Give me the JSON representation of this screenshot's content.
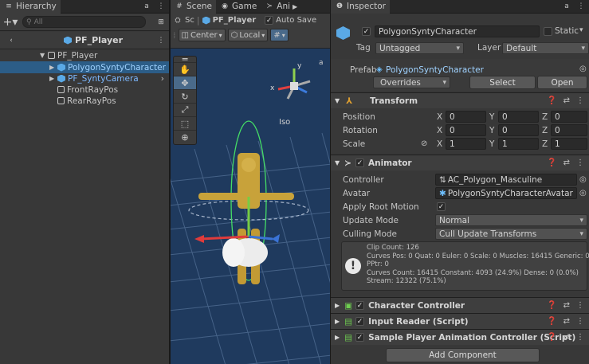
{
  "hierarchy": {
    "tab_label": "Hierarchy",
    "search_placeholder": "All",
    "header_title": "PF_Player",
    "tree": [
      {
        "label": "PF_Player"
      },
      {
        "label": "PolygonSyntyCharacter"
      },
      {
        "label": "PF_SyntyCamera"
      },
      {
        "label": "FrontRayPos"
      },
      {
        "label": "RearRayPos"
      }
    ]
  },
  "scene": {
    "tabs": [
      {
        "label": "Scene"
      },
      {
        "label": "Game"
      },
      {
        "label": "Ani"
      }
    ],
    "breadcrumb_sc": "Sc",
    "breadcrumb_player": "PF_Player",
    "auto_save_label": "Auto Save",
    "pivot_label": "Center",
    "space_label": "Local",
    "iso_label": "Iso",
    "axis_y": "y",
    "axis_x": "x"
  },
  "inspector": {
    "tab_label": "Inspector",
    "object_name": "PolygonSyntyCharacter",
    "static_label": "Static",
    "tag_label": "Tag",
    "tag_value": "Untagged",
    "layer_label": "Layer",
    "layer_value": "Default",
    "prefab_label": "Prefab",
    "prefab_value": "PolygonSyntyCharacter",
    "overrides_label": "Overrides",
    "select_label": "Select",
    "open_label": "Open",
    "transform": {
      "title": "Transform",
      "position_label": "Position",
      "rotation_label": "Rotation",
      "scale_label": "Scale",
      "position": [
        "0",
        "0",
        "0"
      ],
      "rotation": [
        "0",
        "0",
        "0"
      ],
      "scale": [
        "1",
        "1",
        "1"
      ],
      "x": "X",
      "y": "Y",
      "z": "Z"
    },
    "animator": {
      "title": "Animator",
      "controller_label": "Controller",
      "controller_value": "AC_Polygon_Masculine",
      "avatar_label": "Avatar",
      "avatar_value": "PolygonSyntyCharacterAvatar",
      "apply_root_motion_label": "Apply Root Motion",
      "update_mode_label": "Update Mode",
      "update_mode_value": "Normal",
      "culling_mode_label": "Culling Mode",
      "culling_mode_value": "Cull Update Transforms",
      "info_lines": [
        "Clip Count: 126",
        "Curves Pos: 0 Quat: 0 Euler: 0 Scale: 0 Muscles: 16415 Generic: 0",
        "PPtr: 0",
        "Curves Count: 16415 Constant: 4093 (24.9%) Dense: 0 (0.0%)",
        "Stream: 12322 (75.1%)"
      ]
    },
    "components": [
      {
        "title": "Character Controller"
      },
      {
        "title": "Input Reader (Script)"
      },
      {
        "title": "Sample Player Animation Controller (Script)"
      }
    ],
    "add_component_label": "Add Component"
  }
}
